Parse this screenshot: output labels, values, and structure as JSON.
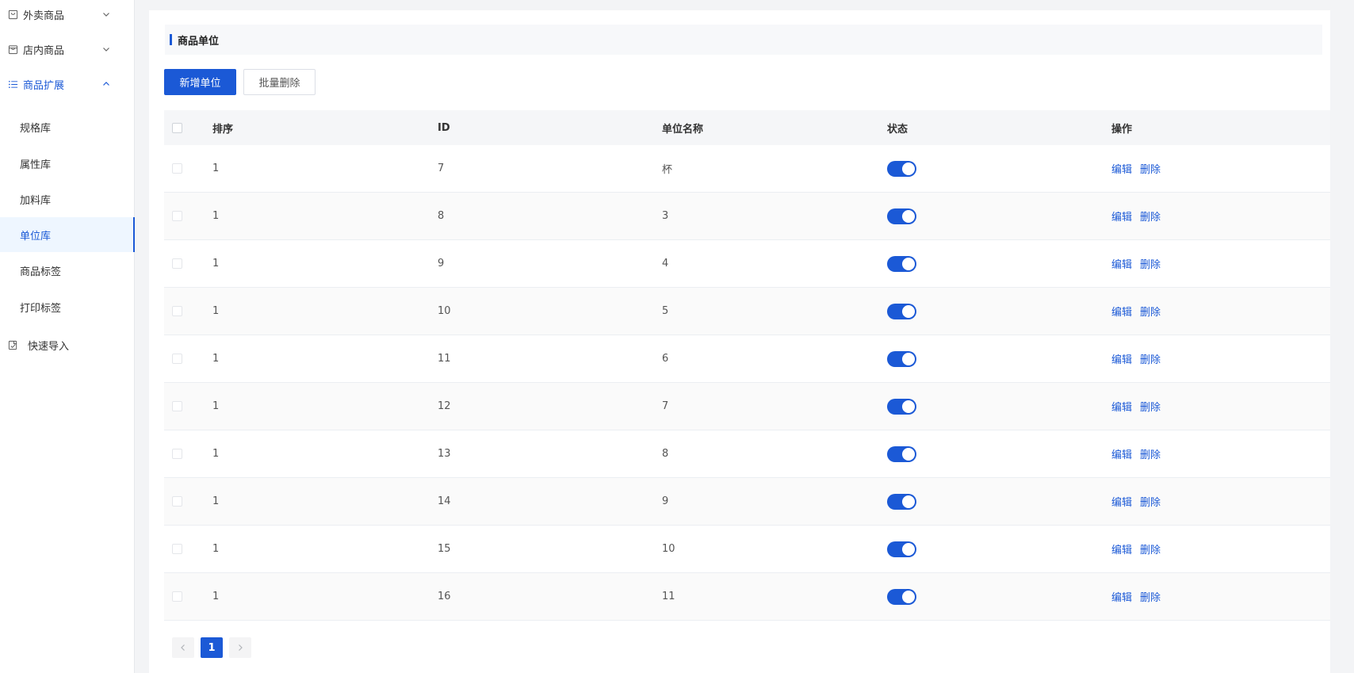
{
  "sidebar": {
    "groups": [
      {
        "label": "外卖商品",
        "icon": "bag-icon",
        "expanded": false
      },
      {
        "label": "店内商品",
        "icon": "bag-icon",
        "expanded": false
      },
      {
        "label": "商品扩展",
        "icon": "list-icon",
        "expanded": true
      },
      {
        "label": "快速导入",
        "icon": "import-icon",
        "expanded": false
      }
    ],
    "sub_items": [
      {
        "label": "规格库"
      },
      {
        "label": "属性库"
      },
      {
        "label": "加料库"
      },
      {
        "label": "单位库",
        "selected": true
      },
      {
        "label": "商品标签"
      },
      {
        "label": "打印标签"
      }
    ]
  },
  "main": {
    "section_title": "商品单位",
    "buttons": {
      "add_label": "新增单位",
      "batch_delete_label": "批量删除"
    },
    "table": {
      "headers": {
        "sort": "排序",
        "id": "ID",
        "name": "单位名称",
        "status": "状态",
        "ops": "操作"
      },
      "rows": [
        {
          "sort": "1",
          "id": "7",
          "name": "杯",
          "status": true
        },
        {
          "sort": "1",
          "id": "8",
          "name": "3",
          "status": true
        },
        {
          "sort": "1",
          "id": "9",
          "name": "4",
          "status": true
        },
        {
          "sort": "1",
          "id": "10",
          "name": "5",
          "status": true
        },
        {
          "sort": "1",
          "id": "11",
          "name": "6",
          "status": true
        },
        {
          "sort": "1",
          "id": "12",
          "name": "7",
          "status": true
        },
        {
          "sort": "1",
          "id": "13",
          "name": "8",
          "status": true
        },
        {
          "sort": "1",
          "id": "14",
          "name": "9",
          "status": true
        },
        {
          "sort": "1",
          "id": "15",
          "name": "10",
          "status": true
        },
        {
          "sort": "1",
          "id": "16",
          "name": "11",
          "status": true
        }
      ],
      "edit_label": "编辑",
      "delete_label": "删除"
    },
    "pagination": {
      "current_page": "1"
    }
  },
  "colors": {
    "accent": "#1b59d6",
    "selected_bg": "#eef6ff"
  }
}
